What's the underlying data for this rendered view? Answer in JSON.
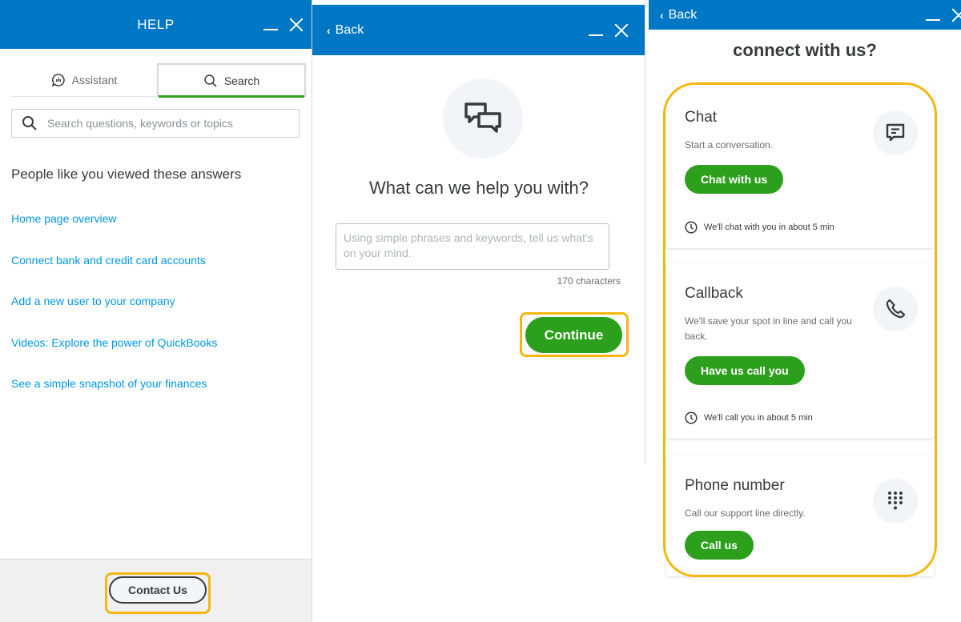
{
  "panel_help": {
    "header_title": "HELP",
    "tabs": [
      {
        "label": "Assistant",
        "icon": "assistant-bubble-icon",
        "active": false
      },
      {
        "label": "Search",
        "icon": "search-icon",
        "active": true
      }
    ],
    "search": {
      "placeholder": "Search questions, keywords or topics",
      "value": ""
    },
    "section_title": "People like you viewed these answers",
    "answers": [
      "Home page overview",
      "Connect bank and credit card accounts",
      "Add a new user to your company",
      "Videos: Explore the power of QuickBooks",
      "See a simple snapshot of your finances"
    ],
    "contact_label": "Contact Us"
  },
  "panel_assist": {
    "back_label": "Back",
    "title": "What can we help you with?",
    "textarea_placeholder": "Using simple phrases and keywords, tell us what's on your mind.",
    "textarea_value": "",
    "char_count": "170 characters",
    "continue_label": "Continue"
  },
  "panel_connect": {
    "back_label": "Back",
    "title": "connect with us?",
    "options": [
      {
        "title": "Chat",
        "description": "Start a conversation.",
        "button": "Chat with us",
        "wait": "We'll chat with you in about 5 min",
        "icon": "chat-message-icon"
      },
      {
        "title": "Callback",
        "description": "We'll save your spot in line and call you back.",
        "button": "Have us call you",
        "wait": "We'll call you in about 5 min",
        "icon": "phone-icon"
      },
      {
        "title": "Phone number",
        "description": "Call our support line directly.",
        "button": "Call us",
        "icon": "keypad-icon"
      }
    ]
  },
  "colors": {
    "header_blue": "#0077c5",
    "primary_green": "#2ca01c",
    "link_blue": "#0097e6",
    "highlight_yellow": "#f5b70f",
    "text_dark": "#393a3d"
  }
}
